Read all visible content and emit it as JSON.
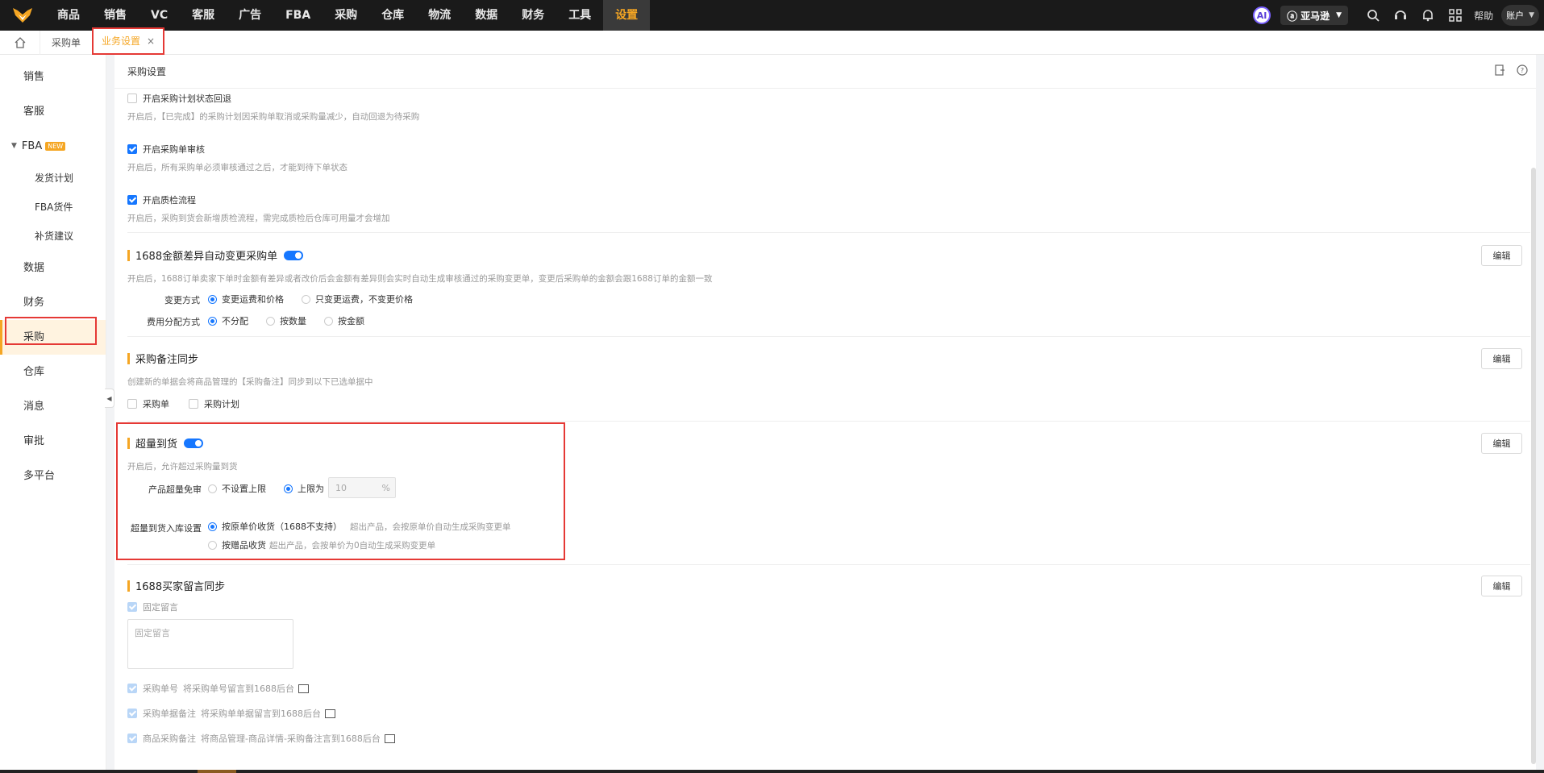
{
  "nav": {
    "items": [
      "商品",
      "销售",
      "VC",
      "客服",
      "广告",
      "FBA",
      "采购",
      "仓库",
      "物流",
      "数据",
      "财务",
      "工具",
      "设置"
    ],
    "active_index": 12,
    "ai_label": "AI",
    "store_label": "亚马逊",
    "help_label": "帮助",
    "account_label": "账户"
  },
  "tabs": {
    "items": [
      {
        "label": "采购单"
      },
      {
        "label": "业务设置"
      }
    ],
    "close_glyph": "×"
  },
  "sidebar": {
    "items": [
      {
        "label": "销售"
      },
      {
        "label": "客服"
      },
      {
        "label": "FBA",
        "badge": "NEW"
      },
      {
        "label": "发货计划"
      },
      {
        "label": "FBA货件"
      },
      {
        "label": "补货建议"
      },
      {
        "label": "数据"
      },
      {
        "label": "财务"
      },
      {
        "label": "采购"
      },
      {
        "label": "仓库"
      },
      {
        "label": "消息"
      },
      {
        "label": "审批"
      },
      {
        "label": "多平台"
      }
    ]
  },
  "main": {
    "header_title": "采购设置",
    "plan_rollback": {
      "label": "开启采购计划状态回退",
      "desc": "开启后，【已完成】的采购计划因采购单取消或采购量减少，自动回退为待采购"
    },
    "order_review": {
      "label": "开启采购单审核",
      "desc": "开启后，所有采购单必须审核通过之后，才能到待下单状态"
    },
    "qc_flow": {
      "label": "开启质检流程",
      "desc": "开启后，采购到货会新增质检流程，需完成质检后仓库可用量才会增加"
    },
    "amount_diff": {
      "title": "1688金额差异自动变更采购单",
      "desc": "开启后，1688订单卖家下单时金额有差异或者改价后会金额有差异则会实时自动生成审核通过的采购变更单，变更后采购单的金额会跟1688订单的金额一致",
      "change_label": "变更方式",
      "change_opt1": "变更运费和价格",
      "change_opt2": "只变更运费，不变更价格",
      "alloc_label": "费用分配方式",
      "alloc_opt1": "不分配",
      "alloc_opt2": "按数量",
      "alloc_opt3": "按金额"
    },
    "remark_sync": {
      "title": "采购备注同步",
      "desc": "创建新的单据会将商品管理的【采购备注】同步到以下已选单据中",
      "opt1": "采购单",
      "opt2": "采购计划"
    },
    "over_arrival": {
      "title": "超量到货",
      "desc": "开启后，允许超过采购量到货",
      "exempt_label": "产品超量免审",
      "exempt_opt1": "不设置上限",
      "exempt_opt2": "上限为",
      "limit_value": "10",
      "limit_unit": "%",
      "inbound_label": "超量到货入库设置",
      "inbound_opt1": "按原单价收货（1688不支持）",
      "inbound_opt1_desc": "超出产品，会按原单价自动生成采购变更单",
      "inbound_opt2": "按赠品收货",
      "inbound_opt2_desc": "超出产品，会按单价为0自动生成采购变更单"
    },
    "buyer_msg": {
      "title": "1688买家留言同步",
      "fixed_label": "固定留言",
      "fixed_placeholder": "固定留言",
      "po_no_label": "采购单号",
      "po_no_desc": "将采购单号留言到1688后台",
      "po_remark_label": "采购单据备注",
      "po_remark_desc": "将采购单单据留言到1688后台",
      "prod_remark_label": "商品采购备注",
      "prod_remark_desc": "将商品管理-商品详情-采购备注言到1688后台"
    },
    "edit_label": "编辑"
  },
  "colors": {
    "accent": "#f5a623",
    "primary": "#1677ff",
    "highlight": "#e53935",
    "nav_bg": "#1a1a1a"
  }
}
